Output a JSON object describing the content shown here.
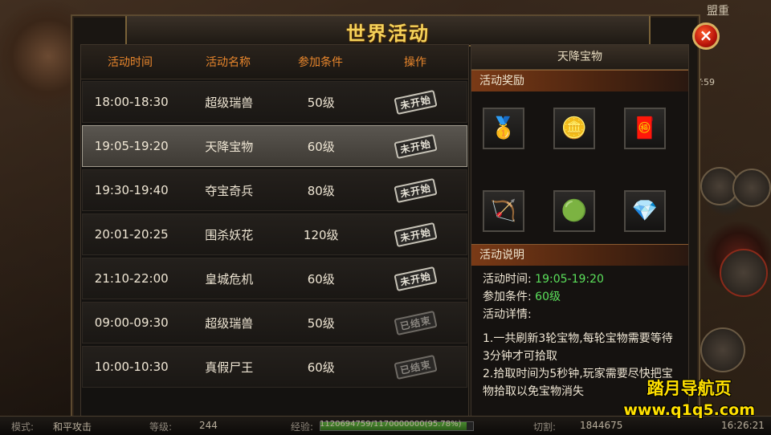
{
  "background": {
    "top_right_label": "盟重",
    "coords": "71 Y:59"
  },
  "window": {
    "title": "世界活动",
    "close_label": "×"
  },
  "table": {
    "headers": [
      "活动时间",
      "活动名称",
      "参加条件",
      "操作"
    ],
    "rows": [
      {
        "time": "18:00-18:30",
        "name": "超级瑞兽",
        "level": "50级",
        "status": "未开始",
        "ended": false,
        "selected": false
      },
      {
        "time": "19:05-19:20",
        "name": "天降宝物",
        "level": "60级",
        "status": "未开始",
        "ended": false,
        "selected": true
      },
      {
        "time": "19:30-19:40",
        "name": "夺宝奇兵",
        "level": "80级",
        "status": "未开始",
        "ended": false,
        "selected": false
      },
      {
        "time": "20:01-20:25",
        "name": "围杀妖花",
        "level": "120级",
        "status": "未开始",
        "ended": false,
        "selected": false
      },
      {
        "time": "21:10-22:00",
        "name": "皇城危机",
        "level": "60级",
        "status": "未开始",
        "ended": false,
        "selected": false
      },
      {
        "time": "09:00-09:30",
        "name": "超级瑞兽",
        "level": "50级",
        "status": "已结束",
        "ended": true,
        "selected": false
      },
      {
        "time": "10:00-10:30",
        "name": "真假尸王",
        "level": "60级",
        "status": "已结束",
        "ended": true,
        "selected": false
      }
    ]
  },
  "detail": {
    "title": "天降宝物",
    "rewards_label": "活动奖励",
    "rewards": [
      {
        "icon": "gold-ingot-icon",
        "glyph": "🥇"
      },
      {
        "icon": "gold-coin-icon",
        "glyph": "🪙"
      },
      {
        "icon": "red-envelope-icon",
        "glyph": "🧧"
      },
      {
        "icon": "golden-bow-icon",
        "glyph": "🏹"
      },
      {
        "icon": "green-orb-icon",
        "glyph": "🟢"
      },
      {
        "icon": "white-gem-icon",
        "glyph": "💎"
      }
    ],
    "info_label": "活动说明",
    "time_label": "活动时间:",
    "time_value": "19:05-19:20",
    "cond_label": "参加条件:",
    "cond_value": "60级",
    "detail_label": "活动详情:",
    "detail_line1": "1.一共刷新3轮宝物,每轮宝物需要等待3分钟才可拾取",
    "detail_line2": "2.拾取时间为5秒钟,玩家需要尽快把宝物拾取以免宝物消失"
  },
  "status_bar": {
    "mode_label": "模式:",
    "mode_value": "和平攻击",
    "level_label": "等级:",
    "level_value": "244",
    "exp_label": "经验:",
    "exp_value": "1120694759/1170000000(95.78%)",
    "exp_fraction": 0.9578,
    "cut_label": "切割:",
    "cut_value": "1844675",
    "clock": "16:26:21"
  },
  "watermark": {
    "line1": "踏月导航页",
    "line2": "www.q1q5.com"
  },
  "colors": {
    "header_orange": "#e8862c",
    "value_green": "#5be05b",
    "title_gold": "#f5d25a",
    "watermark_yellow": "#ffe000"
  }
}
